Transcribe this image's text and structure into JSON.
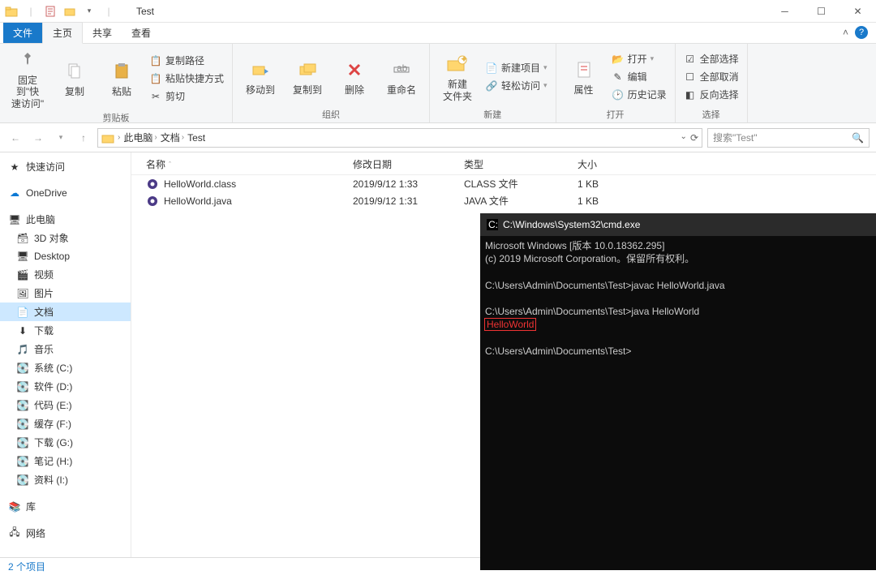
{
  "window": {
    "title": "Test"
  },
  "tabs": {
    "file": "文件",
    "home": "主页",
    "share": "共享",
    "view": "查看"
  },
  "ribbon": {
    "clipboard": {
      "pin": "固定到\"快\n速访问\"",
      "copy": "复制",
      "paste": "粘贴",
      "copyPath": "复制路径",
      "pasteShortcut": "粘贴快捷方式",
      "cut": "剪切",
      "label": "剪贴板"
    },
    "organize": {
      "moveTo": "移动到",
      "copyTo": "复制到",
      "delete": "删除",
      "rename": "重命名",
      "label": "组织"
    },
    "new": {
      "folder": "新建\n文件夹",
      "newItem": "新建项目",
      "easyAccess": "轻松访问",
      "label": "新建"
    },
    "open": {
      "properties": "属性",
      "open": "打开",
      "edit": "编辑",
      "history": "历史记录",
      "label": "打开"
    },
    "select": {
      "all": "全部选择",
      "none": "全部取消",
      "invert": "反向选择",
      "label": "选择"
    }
  },
  "breadcrumb": {
    "pc": "此电脑",
    "docs": "文档",
    "folder": "Test"
  },
  "search": {
    "placeholder": "搜索\"Test\""
  },
  "columns": {
    "name": "名称",
    "date": "修改日期",
    "type": "类型",
    "size": "大小"
  },
  "files": [
    {
      "name": "HelloWorld.class",
      "date": "2019/9/12 1:33",
      "type": "CLASS 文件",
      "size": "1 KB"
    },
    {
      "name": "HelloWorld.java",
      "date": "2019/9/12 1:31",
      "type": "JAVA 文件",
      "size": "1 KB"
    }
  ],
  "sidebar": {
    "quick": "快速访问",
    "onedrive": "OneDrive",
    "thispc": "此电脑",
    "items": [
      "3D 对象",
      "Desktop",
      "视频",
      "图片",
      "文档",
      "下载",
      "音乐",
      "系统 (C:)",
      "软件 (D:)",
      "代码 (E:)",
      "缓存 (F:)",
      "下载 (G:)",
      "笔记 (H:)",
      "资料 (I:)"
    ],
    "selectedIndex": 4,
    "libraries": "库",
    "network": "网络"
  },
  "status": {
    "items": "2 个项目"
  },
  "cmd": {
    "title": "C:\\Windows\\System32\\cmd.exe",
    "line1": "Microsoft Windows [版本 10.0.18362.295]",
    "line2": "(c) 2019 Microsoft Corporation。保留所有权利。",
    "prompt1": "C:\\Users\\Admin\\Documents\\Test>javac HelloWorld.java",
    "prompt2": "C:\\Users\\Admin\\Documents\\Test>java HelloWorld",
    "output": "HelloWorld",
    "prompt3": "C:\\Users\\Admin\\Documents\\Test>"
  }
}
